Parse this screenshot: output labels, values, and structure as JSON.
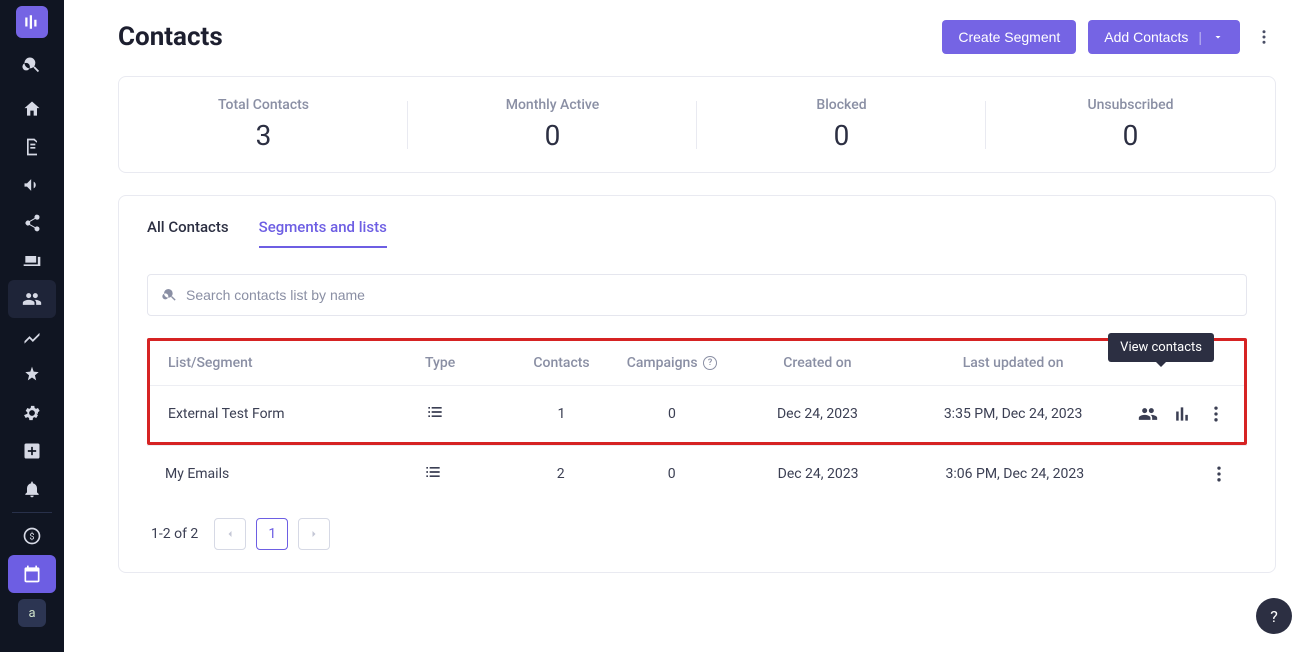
{
  "sidebar": {
    "avatar_letter": "a"
  },
  "header": {
    "title": "Contacts",
    "create_segment_label": "Create Segment",
    "add_contacts_label": "Add Contacts"
  },
  "stats": [
    {
      "label": "Total Contacts",
      "value": "3"
    },
    {
      "label": "Monthly Active",
      "value": "0"
    },
    {
      "label": "Blocked",
      "value": "0"
    },
    {
      "label": "Unsubscribed",
      "value": "0"
    }
  ],
  "tabs": {
    "all_contacts": "All Contacts",
    "segments_lists": "Segments and lists"
  },
  "search": {
    "placeholder": "Search contacts list by name"
  },
  "table": {
    "columns": {
      "name": "List/Segment",
      "type": "Type",
      "contacts": "Contacts",
      "campaigns": "Campaigns",
      "created": "Created on",
      "updated": "Last updated on"
    },
    "rows": [
      {
        "name": "External Test Form",
        "contacts": "1",
        "campaigns": "0",
        "created": "Dec 24, 2023",
        "updated": "3:35 PM, Dec 24, 2023"
      },
      {
        "name": "My Emails",
        "contacts": "2",
        "campaigns": "0",
        "created": "Dec 24, 2023",
        "updated": "3:06 PM, Dec 24, 2023"
      }
    ]
  },
  "tooltip": {
    "view_contacts": "View contacts"
  },
  "pager": {
    "summary": "1-2 of 2",
    "current": "1"
  },
  "help_q": "?"
}
